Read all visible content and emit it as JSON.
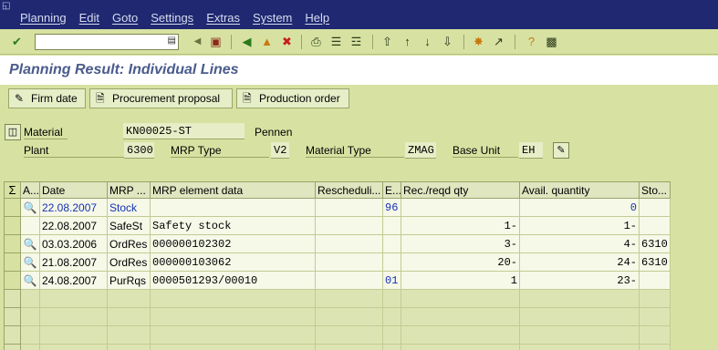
{
  "menu": [
    "Planning",
    "Edit",
    "Goto",
    "Settings",
    "Extras",
    "System",
    "Help"
  ],
  "toolbar": {
    "command_value": "",
    "icons": [
      "enter-icon",
      "save-icon",
      "back-icon",
      "exit-icon",
      "cancel-icon",
      "print-icon",
      "find-icon",
      "find-next-icon",
      "first-page-icon",
      "prev-page-icon",
      "next-page-icon",
      "last-page-icon",
      "new-session-icon",
      "shortcut-icon",
      "help-icon",
      "layout-icon"
    ]
  },
  "title": "Planning Result: Individual Lines",
  "app_buttons": [
    {
      "label": "Firm date",
      "icon": "pencil-icon"
    },
    {
      "label": "Procurement proposal",
      "icon": "document-icon"
    },
    {
      "label": "Production order",
      "icon": "document-icon"
    }
  ],
  "header": {
    "material_label": "Material",
    "material_value": "KN00025-ST",
    "material_desc": "Pennen",
    "plant_label": "Plant",
    "plant_value": "6300",
    "mrp_type_label": "MRP Type",
    "mrp_type_value": "V2",
    "material_type_label": "Material Type",
    "material_type_value": "ZMAG",
    "base_unit_label": "Base Unit",
    "base_unit_value": "EH"
  },
  "grid": {
    "columns": [
      "A...",
      "Date",
      "MRP ...",
      "MRP element data",
      "Rescheduli...",
      "E...",
      "Rec./reqd qty",
      "Avail. quantity",
      "Sto..."
    ],
    "rows": [
      {
        "icon": true,
        "date": "22.08.2007",
        "mrp": "Stock",
        "data": "",
        "resched": "",
        "e": "96",
        "qty": "",
        "avail": "0",
        "sto": "",
        "blue": true
      },
      {
        "icon": false,
        "date": "22.08.2007",
        "mrp": "SafeSt",
        "data": "Safety stock",
        "resched": "",
        "e": "",
        "qty": "1-",
        "avail": "1-",
        "sto": "",
        "blue": false
      },
      {
        "icon": true,
        "date": "03.03.2006",
        "mrp": "OrdRes",
        "data": "000000102302",
        "resched": "",
        "e": "",
        "qty": "3-",
        "avail": "4-",
        "sto": "6310",
        "blue": false
      },
      {
        "icon": true,
        "date": "21.08.2007",
        "mrp": "OrdRes",
        "data": "000000103062",
        "resched": "",
        "e": "",
        "qty": "20-",
        "avail": "24-",
        "sto": "6310",
        "blue": false
      },
      {
        "icon": true,
        "date": "24.08.2007",
        "mrp": "PurRqs",
        "data": "0000501293/00010",
        "resched": "",
        "e": "01",
        "qty": "1",
        "avail": "23-",
        "sto": "",
        "blue": false
      }
    ]
  }
}
